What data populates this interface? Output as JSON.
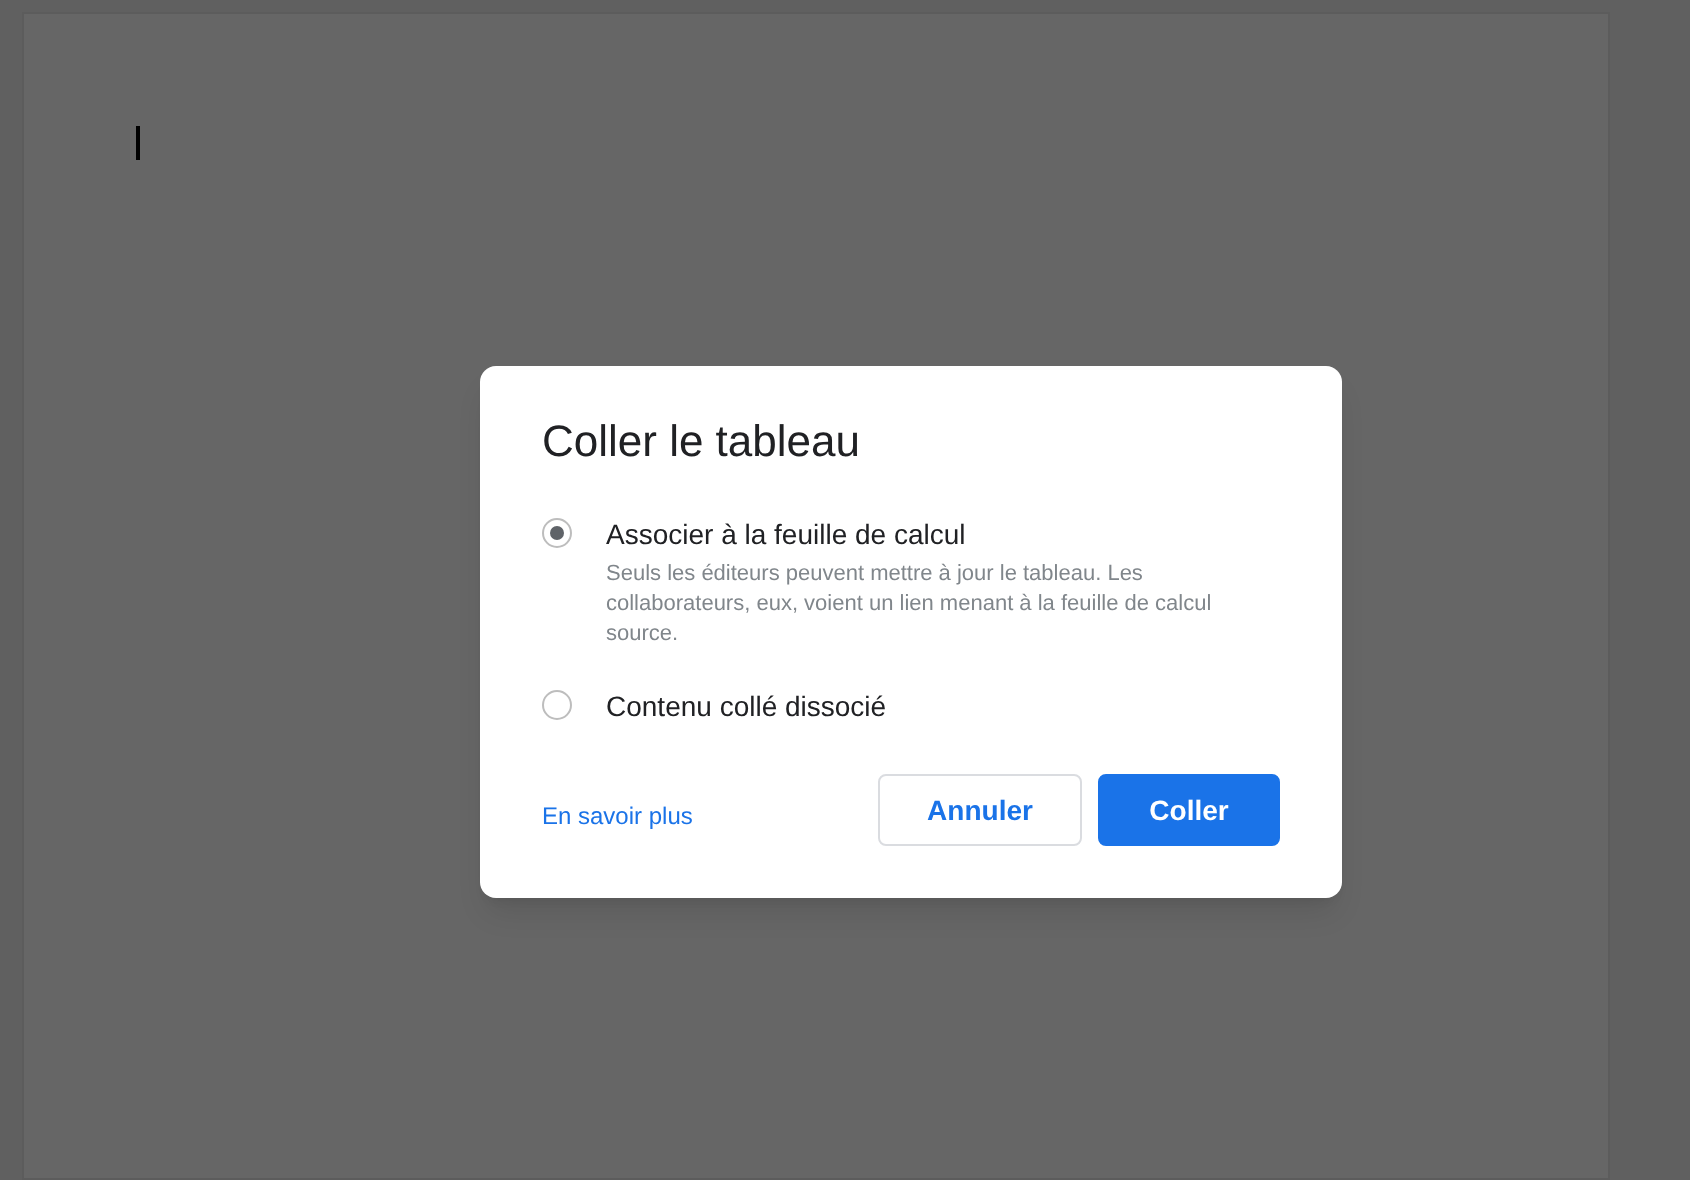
{
  "dialog": {
    "title": "Coller le tableau",
    "options": [
      {
        "label": "Associer à la feuille de calcul",
        "selected": true,
        "description": "Seuls les éditeurs peuvent mettre à jour le tableau. Les collaborateurs, eux, voient un lien menant à la feuille de calcul source."
      },
      {
        "label": "Contenu collé dissocié",
        "selected": false
      }
    ],
    "link": "En savoir plus",
    "buttons": [
      {
        "label": "Annuler",
        "kind": "secondary"
      },
      {
        "label": "Coller",
        "kind": "primary"
      }
    ]
  }
}
